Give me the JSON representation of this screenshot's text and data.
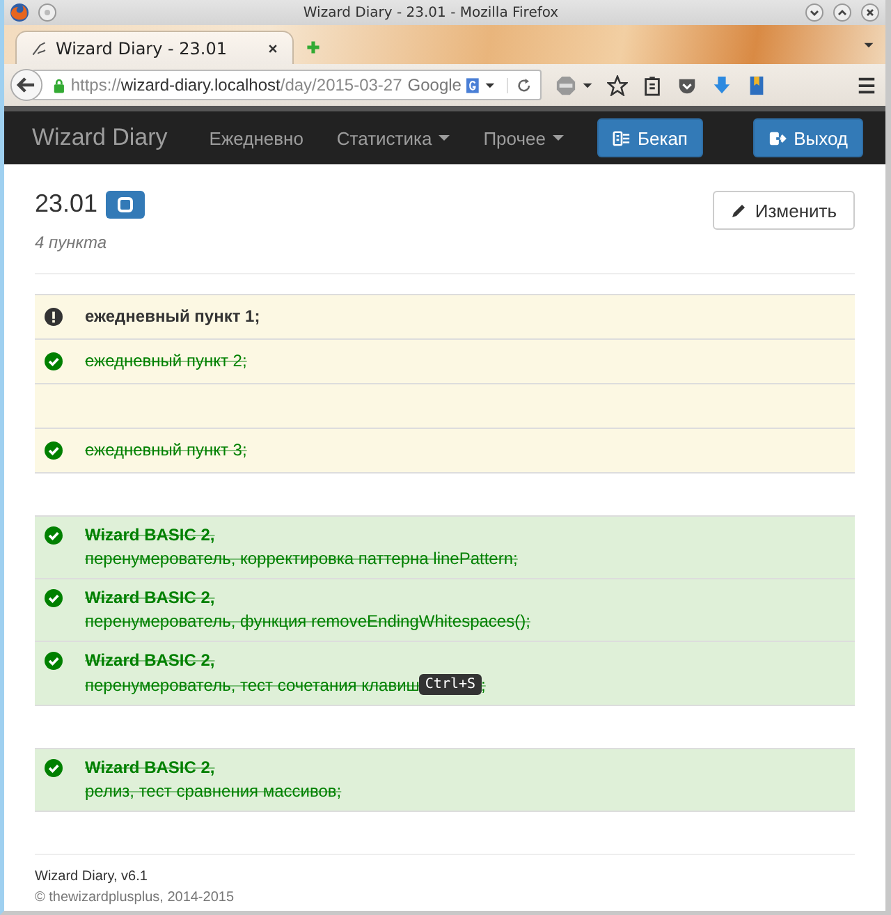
{
  "window": {
    "title": "Wizard Diary - 23.01 - Mozilla Firefox"
  },
  "tab": {
    "title": "Wizard Diary - 23.01"
  },
  "address_bar": {
    "scheme": "https://",
    "host": "wizard-diary.localhost",
    "path": "/day/2015-03-27",
    "search_engine": "Google"
  },
  "navbar": {
    "brand": "Wizard Diary",
    "items": [
      {
        "label": "Ежедневно",
        "kind": "link",
        "dropdown": false
      },
      {
        "label": "Статистика",
        "kind": "link",
        "dropdown": true
      },
      {
        "label": "Прочее",
        "kind": "link",
        "dropdown": true
      },
      {
        "label": "Бекап",
        "kind": "button",
        "dropdown": false
      }
    ],
    "logout": "Выход"
  },
  "header": {
    "title": "23.01",
    "subtitle": "4 пункта",
    "edit_button": "Изменить"
  },
  "groups": [
    {
      "kind": "daily",
      "items": [
        {
          "kind": "entry",
          "done": false,
          "text": "ежедневный пункт 1;"
        },
        {
          "kind": "entry",
          "done": true,
          "text": "ежедневный пункт 2;"
        },
        {
          "kind": "blank"
        },
        {
          "kind": "entry",
          "done": true,
          "text": "ежедневный пункт 3;"
        }
      ]
    },
    {
      "kind": "project",
      "items": [
        {
          "kind": "entry",
          "done": true,
          "heading": "Wizard BASIC 2,",
          "text": "перенумерователь, корректировка паттерна linePattern;"
        },
        {
          "kind": "entry",
          "done": true,
          "heading": "Wizard BASIC 2,",
          "text": "перенумерователь, функция removeEndingWhitespaces();"
        },
        {
          "kind": "entry",
          "done": true,
          "heading": "Wizard BASIC 2,",
          "text": "перенумерователь, тест сочетания клавиш",
          "kbd": "Ctrl+S",
          "text_after": ";"
        }
      ]
    },
    {
      "kind": "project",
      "items": [
        {
          "kind": "entry",
          "done": true,
          "heading": "Wizard BASIC 2,",
          "text": "релиз, тест сравнения массивов;"
        }
      ]
    }
  ],
  "footer": {
    "version": "Wizard Diary, v6.1",
    "copyright": "© thewizardplusplus, 2014-2015"
  }
}
